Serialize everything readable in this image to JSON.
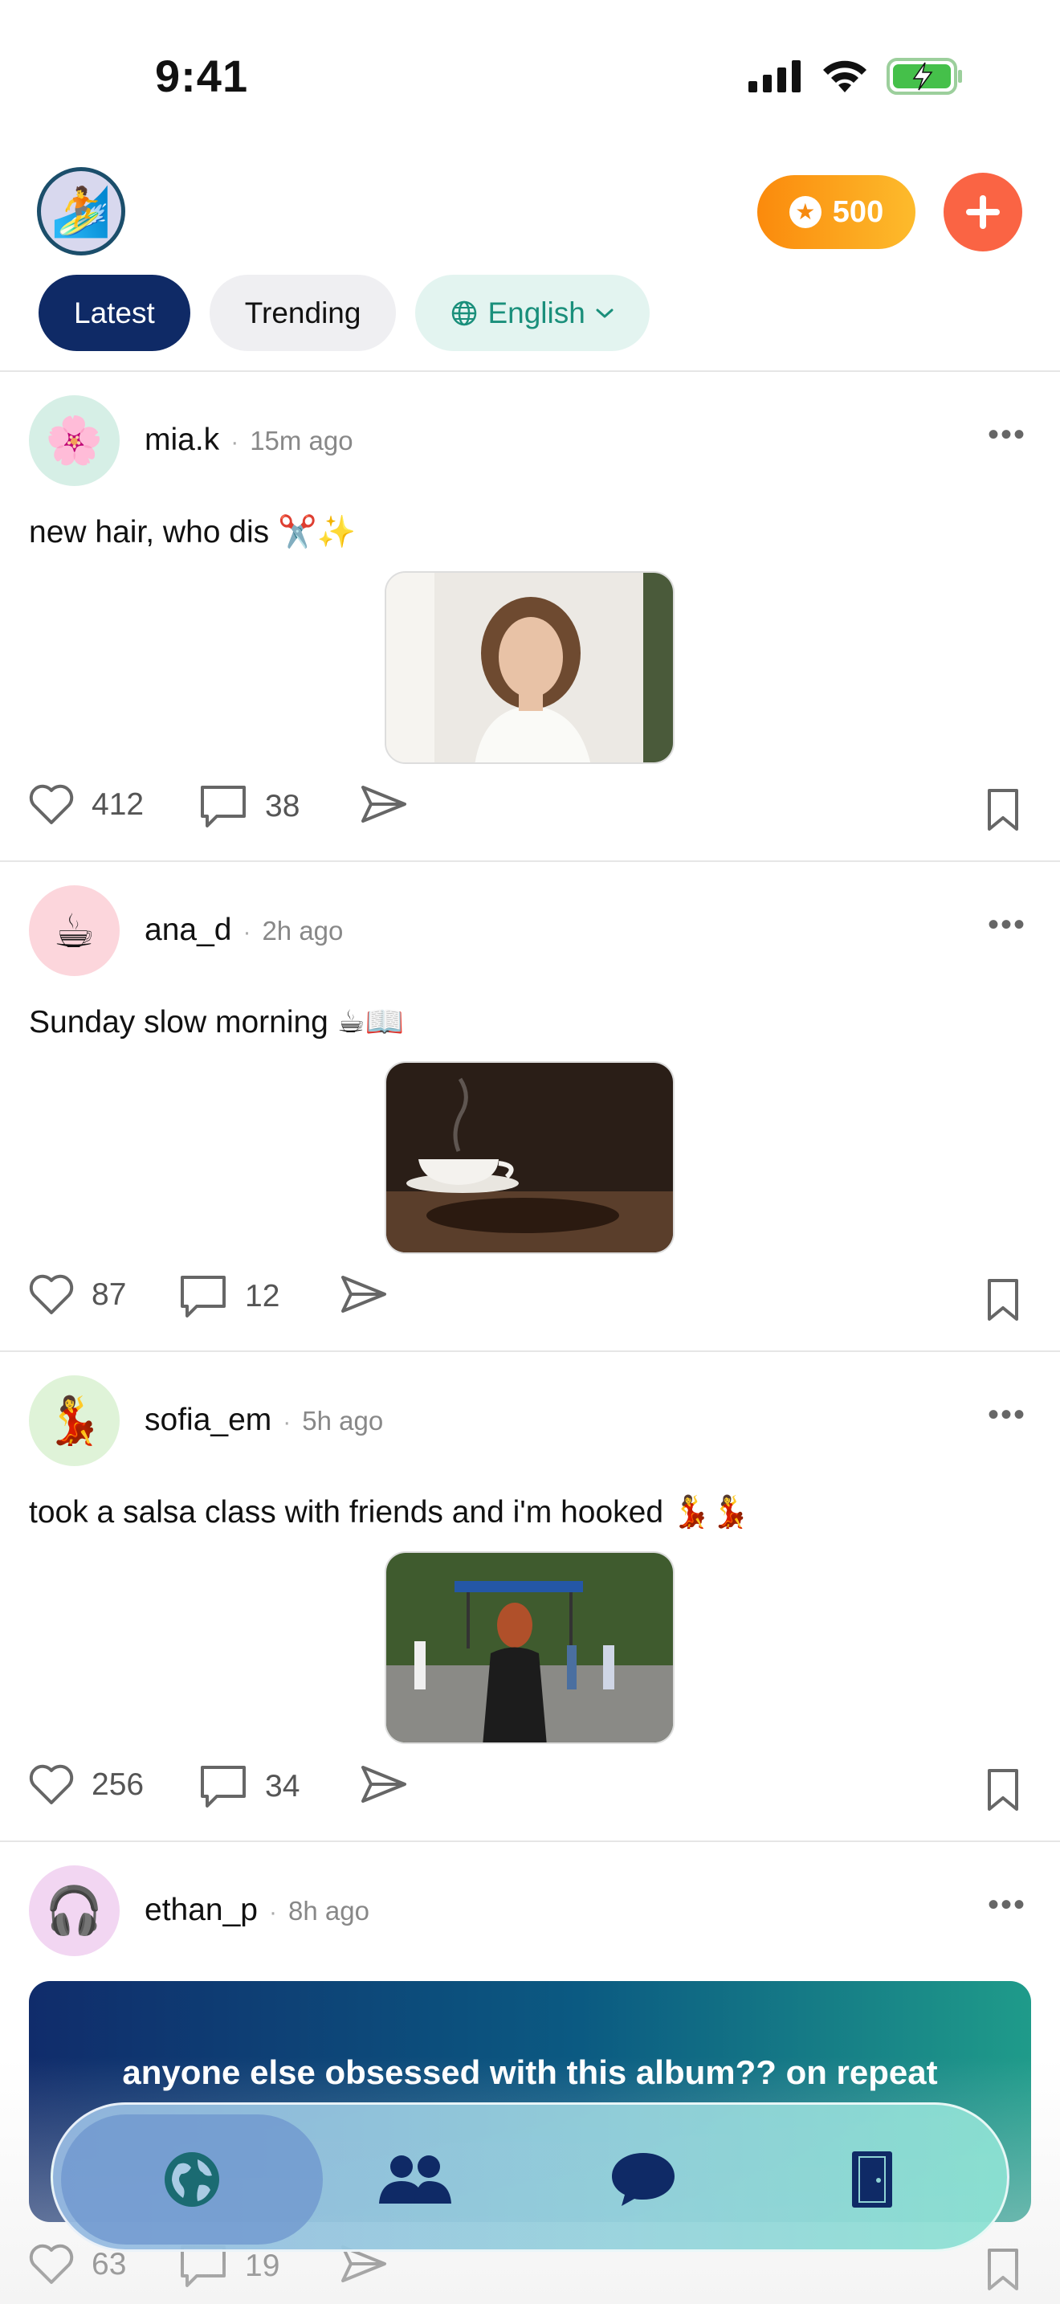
{
  "status_bar": {
    "time": "9:41"
  },
  "header": {
    "avatar_emoji": "🏄",
    "coins": "500",
    "add_icon": "plus-icon"
  },
  "tabs": [
    {
      "label": "Latest",
      "active": true
    },
    {
      "label": "Trending",
      "active": false
    },
    {
      "label": "English",
      "icon": "globe-icon",
      "dropdown": true
    }
  ],
  "posts": [
    {
      "user": "mia.k",
      "time": "15m ago",
      "avatar_emoji": "🌸",
      "avatar_bg": "#d6efe6",
      "caption": "new hair, who dis ✂️✨",
      "likes": "412",
      "comments": "38"
    },
    {
      "user": "ana_d",
      "time": "2h ago",
      "avatar_emoji": "☕",
      "avatar_bg": "#fcd6dc",
      "caption": "Sunday slow morning ☕📖",
      "likes": "87",
      "comments": "12"
    },
    {
      "user": "sofia_em",
      "time": "5h ago",
      "avatar_emoji": "💃",
      "avatar_bg": "#dff3d8",
      "caption": "took a salsa class with friends and i'm hooked 💃💃",
      "likes": "256",
      "comments": "34"
    },
    {
      "user": "ethan_p",
      "time": "8h ago",
      "avatar_emoji": "🎧",
      "avatar_bg": "#f2d6f2",
      "caption": "anyone else obsessed with this album?? on repeat",
      "likes": "63",
      "comments": "19"
    }
  ],
  "bottom_nav": [
    {
      "name": "globe-icon",
      "active": true
    },
    {
      "name": "people-icon",
      "active": false
    },
    {
      "name": "chat-icon",
      "active": false
    },
    {
      "name": "door-icon",
      "active": false
    }
  ],
  "colors": {
    "primary": "#0f2a66",
    "accent_orange": "#fa6444",
    "coin_orange": "#fb8a0c",
    "teal": "#1a8f7b"
  }
}
